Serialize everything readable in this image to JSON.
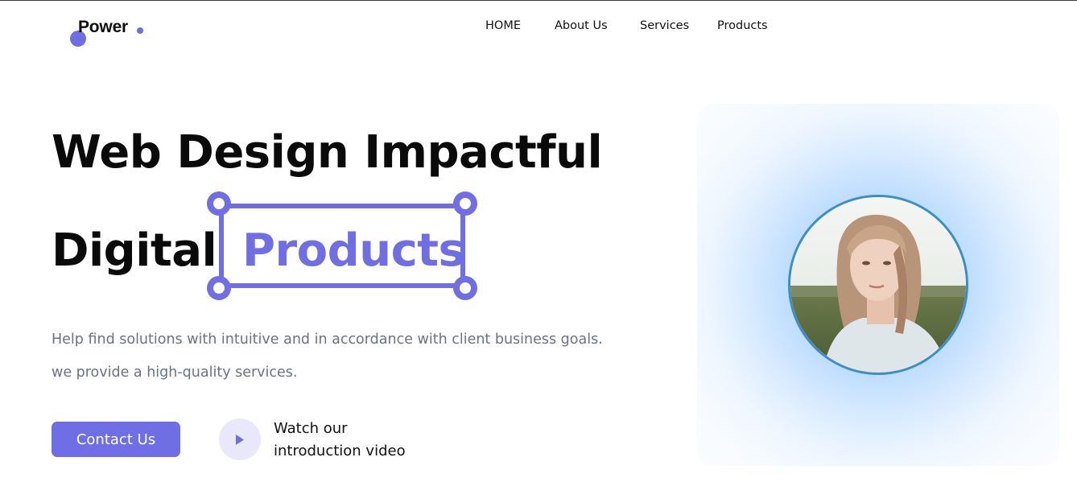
{
  "brand": {
    "name": "Power",
    "accent_color": "#6f6ee5"
  },
  "nav": {
    "items": [
      {
        "label": "HOME"
      },
      {
        "label": "About Us"
      },
      {
        "label": "Services"
      },
      {
        "label": "Products"
      }
    ]
  },
  "hero": {
    "title_line1": "Web Design Impactful",
    "title_line2_prefix": "Digital",
    "title_highlight": "Products",
    "description_line1": "Help find solutions with intuitive and in accordance with client business goals.",
    "description_line2": "we provide a high-quality services.",
    "cta_label": "Contact Us",
    "video_label_line1": "Watch our",
    "video_label_line2": "introduction video",
    "video_icon": "play-icon"
  },
  "media": {
    "avatar_icon": "portrait-photo",
    "card_glow_color": "#8fc4ff",
    "avatar_border_color": "#3d8ec4"
  }
}
